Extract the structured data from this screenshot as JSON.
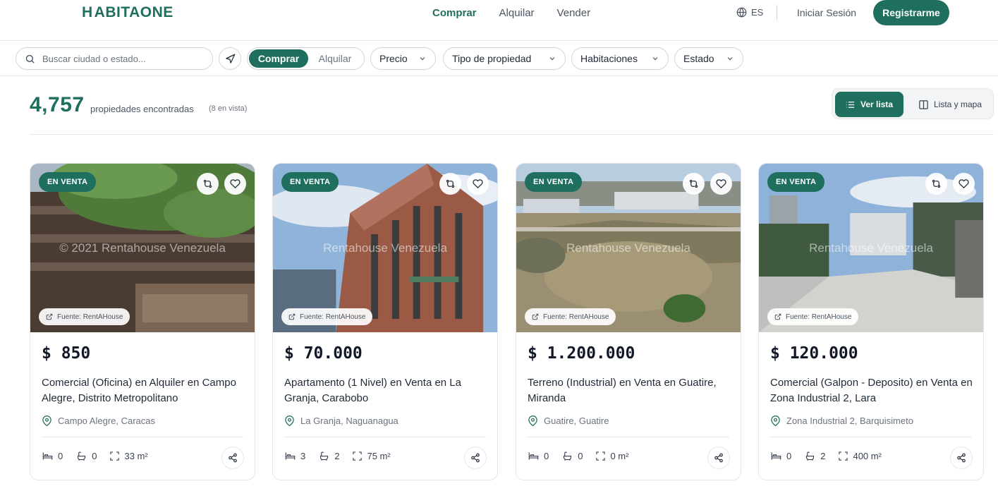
{
  "brand": {
    "logo_text": "ABITAONE",
    "logo_letter": "H"
  },
  "nav": {
    "links": [
      "Comprar",
      "Alquilar",
      "Vender"
    ],
    "lang": "ES",
    "login": "Iniciar Sesión",
    "register": "Registrarme"
  },
  "filters": {
    "search_placeholder": "Buscar ciudad o estado...",
    "mode_on": "Comprar",
    "mode_off": "Alquilar",
    "dropdowns": [
      "Precio",
      "Tipo de propiedad",
      "Habitaciones",
      "Estado"
    ]
  },
  "results": {
    "count": "4,757",
    "label": "propiedades encontradas",
    "in_view": "(8 en vista)"
  },
  "view_toggle": {
    "list": "Ver lista",
    "map": "Lista y mapa"
  },
  "colors": {
    "brand": "#1f6f5f"
  },
  "cards": [
    {
      "badge": "EN VENTA",
      "watermark": "© 2021 Rentahouse Venezuela",
      "source": "Fuente: RentAHouse",
      "price": "$ 850",
      "title": "Comercial (Oficina) en Alquiler en Campo Alegre, Distrito Metropolitano",
      "location": "Campo Alegre, Caracas",
      "beds": "0",
      "baths": "0",
      "area": "33 m²"
    },
    {
      "badge": "EN VENTA",
      "watermark": "Rentahouse Venezuela",
      "source": "Fuente: RentAHouse",
      "price": "$ 70.000",
      "title": "Apartamento (1 Nivel) en Venta en La Granja, Carabobo",
      "location": "La Granja, Naguanagua",
      "beds": "3",
      "baths": "2",
      "area": "75 m²"
    },
    {
      "badge": "EN VENTA",
      "watermark": "Rentahouse Venezuela",
      "source": "Fuente: RentAHouse",
      "price": "$ 1.200.000",
      "title": "Terreno (Industrial) en Venta en Guatire, Miranda",
      "location": "Guatire, Guatire",
      "beds": "0",
      "baths": "0",
      "area": "0 m²"
    },
    {
      "badge": "EN VENTA",
      "watermark": "Rentahouse Venezuela",
      "source": "Fuente: RentAHouse",
      "price": "$ 120.000",
      "title": "Comercial (Galpon - Deposito) en Venta en Zona Industrial 2, Lara",
      "location": "Zona Industrial 2, Barquisimeto",
      "beds": "0",
      "baths": "2",
      "area": "400 m²"
    }
  ]
}
